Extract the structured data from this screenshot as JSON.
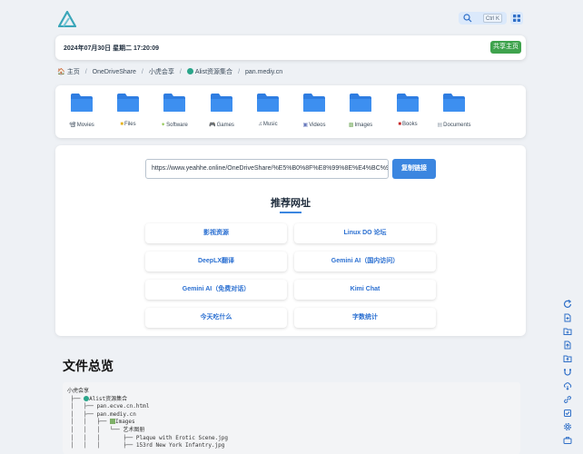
{
  "header": {
    "search_shortcut": "Ctrl K"
  },
  "datebar": {
    "date_text": "2024年07月30日 星期二 17:20:09",
    "share_label": "共享主页"
  },
  "breadcrumb": [
    "主页",
    "OneDriveShare",
    "小虎会享",
    "Alist资源集合",
    "pan.mediy.cn"
  ],
  "folders": [
    {
      "label": "Movies",
      "icon": "movie-icon"
    },
    {
      "label": "Files",
      "icon": "folder-icon"
    },
    {
      "label": "Software",
      "icon": "software-icon"
    },
    {
      "label": "Games",
      "icon": "gamepad-icon"
    },
    {
      "label": "Music",
      "icon": "music-icon"
    },
    {
      "label": "Videos",
      "icon": "video-icon"
    },
    {
      "label": "Images",
      "icon": "image-icon"
    },
    {
      "label": "Books",
      "icon": "book-icon"
    },
    {
      "label": "Documents",
      "icon": "document-icon"
    }
  ],
  "share": {
    "url_value": "https://www.yeahhe.online/OneDriveShare/%E5%B0%8F%E8%99%8E%E4%BC%9A%E",
    "copy_label": "复制链接",
    "rec_title": "推荐网址"
  },
  "links": [
    "影视资源",
    "Linux DO 论坛",
    "DeepLX翻译",
    "Gemini AI（国内访问）",
    "Gemini AI（免费对话）",
    "Kimi Chat",
    "今天吃什么",
    "字数统计"
  ],
  "overview": {
    "title": "文件总览",
    "tree": {
      "l0": "小虎会享",
      "l1": "Alist资源集合",
      "l2": "pan.ecve.cn.html",
      "l3": "pan.mediy.cn",
      "l4": "Images",
      "l5": "艺术图册",
      "l6": "Plaque with Erotic Scene.jpg",
      "l7": "153rd New York Infantry.jpg"
    }
  },
  "colors": {
    "accent": "#3b86e0",
    "share_green": "#3fa34d",
    "folder_blue": "#2f7de1",
    "link_blue": "#2a6fd1"
  }
}
